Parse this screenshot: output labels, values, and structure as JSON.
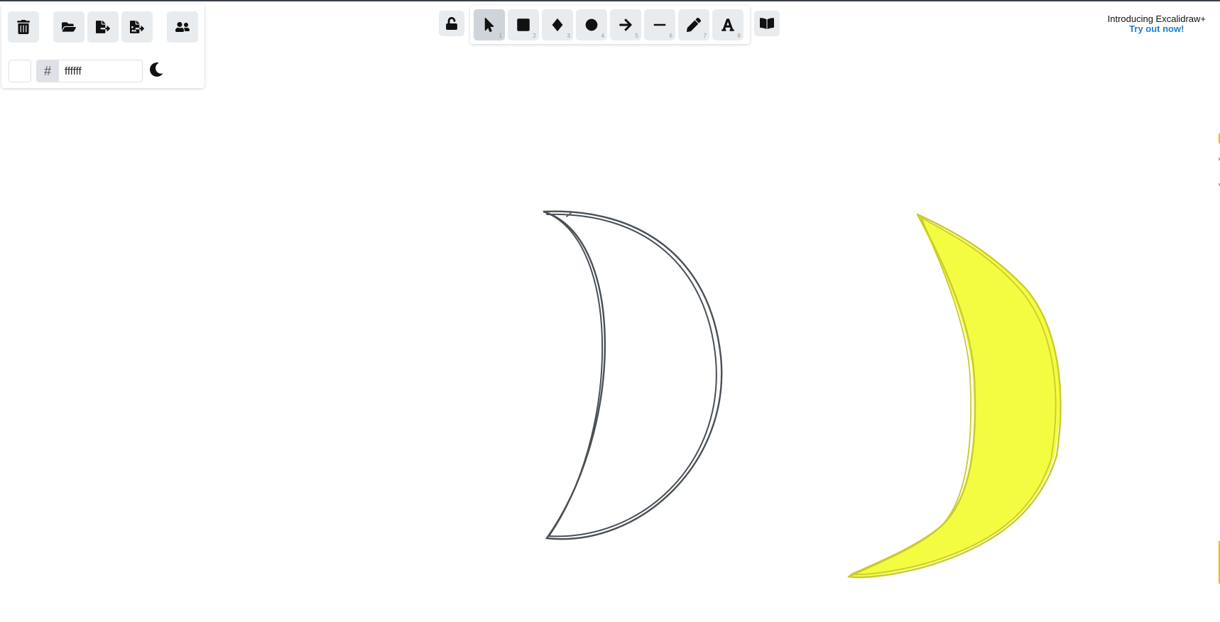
{
  "app": {
    "name": "Excalidraw"
  },
  "left_panel": {
    "buttons": [
      {
        "name": "clear-canvas-button",
        "icon": "trash-icon"
      },
      {
        "name": "load-button",
        "icon": "folder-open-icon"
      },
      {
        "name": "save-button",
        "icon": "file-export-icon"
      },
      {
        "name": "export-image-button",
        "icon": "image-export-icon"
      },
      {
        "name": "collaborate-button",
        "icon": "users-icon"
      }
    ],
    "background_color": {
      "hash": "#",
      "value": "ffffff",
      "swatch": "#ffffff"
    },
    "theme_toggle_icon": "moon-icon"
  },
  "toolbar": {
    "lock_icon": "unlock-icon",
    "tools": [
      {
        "key": "selection",
        "icon": "pointer-icon",
        "shortcut": "1",
        "active": true
      },
      {
        "key": "rectangle",
        "icon": "square-icon",
        "shortcut": "2",
        "active": false
      },
      {
        "key": "diamond",
        "icon": "diamond-icon",
        "shortcut": "3",
        "active": false
      },
      {
        "key": "ellipse",
        "icon": "circle-icon",
        "shortcut": "4",
        "active": false
      },
      {
        "key": "arrow",
        "icon": "arrow-right-icon",
        "shortcut": "5",
        "active": false
      },
      {
        "key": "line",
        "icon": "line-icon",
        "shortcut": "6",
        "active": false
      },
      {
        "key": "draw",
        "icon": "pencil-icon",
        "shortcut": "7",
        "active": false
      },
      {
        "key": "text",
        "icon": "text-icon",
        "shortcut": "8",
        "active": false
      }
    ],
    "library_icon": "book-open-icon"
  },
  "promo": {
    "title": "Introducing Excalidraw+",
    "link": "Try out now!"
  },
  "canvas": {
    "shapes": [
      {
        "name": "crescent-outline",
        "stroke": "#495057",
        "fill": "none"
      },
      {
        "name": "crescent-yellow",
        "stroke": "#c9cc2e",
        "fill": "#f4fc42"
      }
    ]
  }
}
